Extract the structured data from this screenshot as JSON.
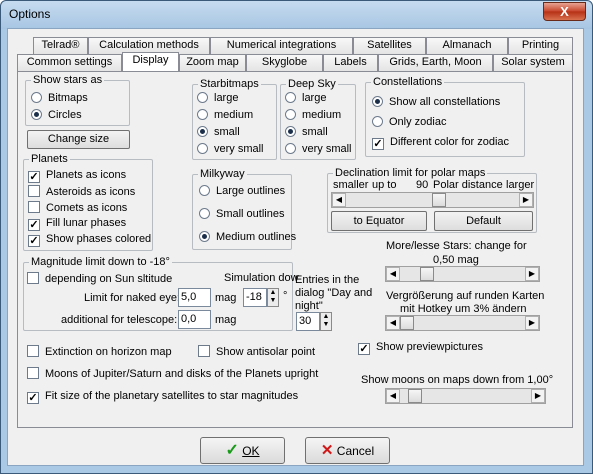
{
  "window": {
    "title": "Options",
    "close": "X"
  },
  "tabs_row1": [
    "Telrad®",
    "Calculation methods",
    "Numerical integrations",
    "Satellites",
    "Almanach",
    "Printing"
  ],
  "tabs_row2": [
    "Common settings",
    "Display",
    "Zoom map",
    "Skyglobe",
    "Labels",
    "Grids, Earth, Moon",
    "Solar system"
  ],
  "show_stars": {
    "legend": "Show stars as",
    "options": [
      "Bitmaps",
      "Circles"
    ],
    "selected": "Circles",
    "change_size": "Change size"
  },
  "starbitmaps": {
    "legend": "Starbitmaps",
    "options": [
      "large",
      "medium",
      "small",
      "very small"
    ],
    "selected": "small"
  },
  "deep_sky": {
    "legend": "Deep Sky",
    "options": [
      "large",
      "medium",
      "small",
      "very small"
    ],
    "selected": "small"
  },
  "constellations": {
    "legend": "Constellations",
    "options": [
      "Show all constellations",
      "Only zodiac"
    ],
    "selected": "Show all constellations",
    "different_color": "Different color for zodiac",
    "different_color_checked": true
  },
  "planets": {
    "legend": "Planets",
    "items": [
      {
        "label": "Planets as icons",
        "checked": true
      },
      {
        "label": "Asteroids as icons",
        "checked": false
      },
      {
        "label": "Comets as icons",
        "checked": false
      },
      {
        "label": "Fill lunar phases",
        "checked": true
      },
      {
        "label": "Show phases colored",
        "checked": true
      }
    ]
  },
  "milkyway": {
    "legend": "Milkyway",
    "options": [
      "Large outlines",
      "Small outlines",
      "Medium outlines"
    ],
    "selected": "Medium outlines"
  },
  "declination": {
    "legend": "Declination limit for polar maps",
    "smaller": "smaller",
    "up_to": "up to",
    "value": "90",
    "polar_distance": "Polar distance",
    "larger": "larger",
    "to_equator": "to Equator",
    "default": "Default",
    "level": 0.05
  },
  "magnitude": {
    "legend": "Magnitude limit down to -18°",
    "depending_sun": "depending on Sun sltitude",
    "depending_checked": false,
    "simulation": "Simulation dow",
    "naked_eye_label": "Limit for naked eye:",
    "naked_eye_value": "5,0",
    "mag": "mag",
    "sim_value": "-18",
    "deg": "°",
    "telescope_label": "additional for telescope:",
    "telescope_value": "0,0"
  },
  "entries": {
    "label": "Entries in the dialog \"Day and night\"",
    "value": "30"
  },
  "more_less_stars": {
    "label": "More/lesse Stars: change for",
    "value": "0,50 mag",
    "level": 0.2
  },
  "vergroesserung": {
    "line1": "Vergrößerung auf runden Karten",
    "line2": "mit Hotkey um 3% ändern",
    "level": 0.0
  },
  "show_preview": {
    "label": "Show previewpictures",
    "checked": true
  },
  "show_moons": {
    "label": "Show moons on maps down from 1,00°",
    "level": 0.05
  },
  "extinction": {
    "label": "Extinction on horizon map",
    "checked": false
  },
  "antisolar": {
    "label": "Show antisolar point",
    "checked": false
  },
  "moons_upright": {
    "label": "Moons of Jupiter/Saturn and disks of the Planets upright",
    "checked": false
  },
  "fit_size": {
    "label": "Fit size of the planetary satellites to star magnitudes",
    "checked": true
  },
  "buttons": {
    "ok": "OK",
    "cancel": "Cancel"
  },
  "colors": {
    "ok_check": "#1a9a1a",
    "cancel_x": "#d01818"
  }
}
